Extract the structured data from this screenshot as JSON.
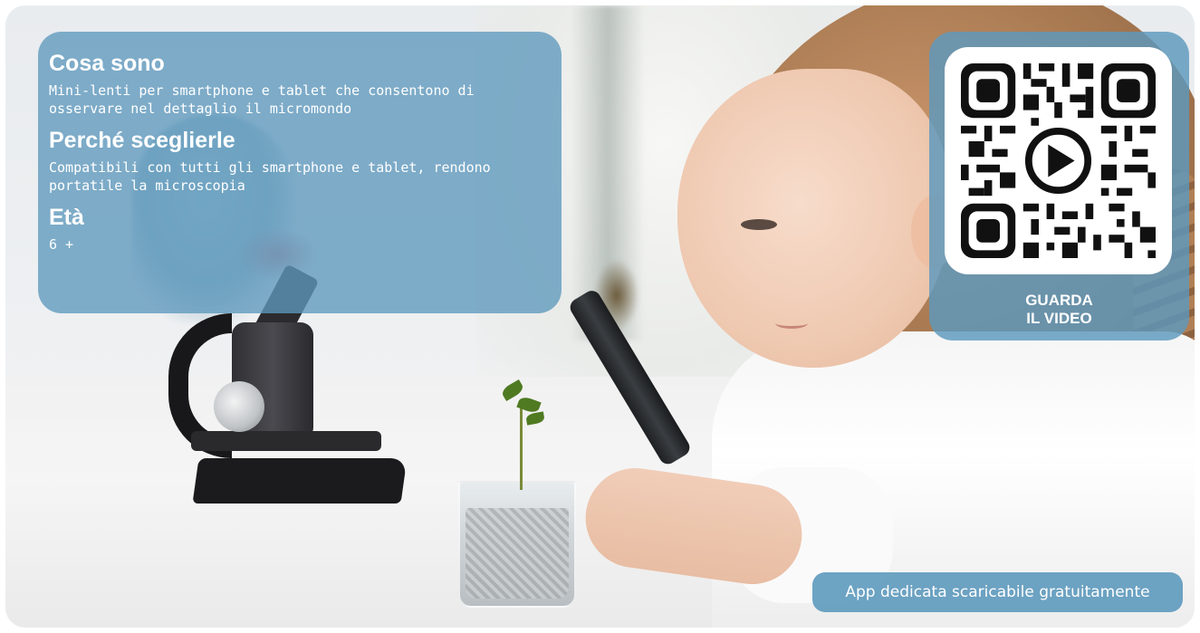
{
  "info": {
    "heading_1": "Cosa sono",
    "text_1": "Mini-lenti per smartphone e tablet che consentono di osservare nel dettaglio il micromondo",
    "heading_2": "Perché sceglierle",
    "text_2": "Compatibili con tutti gli smartphone e tablet, rendono portatile la microscopia",
    "heading_3": "Età",
    "text_3": "6 +"
  },
  "video": {
    "icon": "play-icon",
    "label_line_1": "GUARDA",
    "label_line_2": "IL VIDEO"
  },
  "app_note": "App dedicata scaricabile gratuitamente",
  "colors": {
    "panel_blue": "#5d99bd",
    "text_white": "#ffffff"
  }
}
